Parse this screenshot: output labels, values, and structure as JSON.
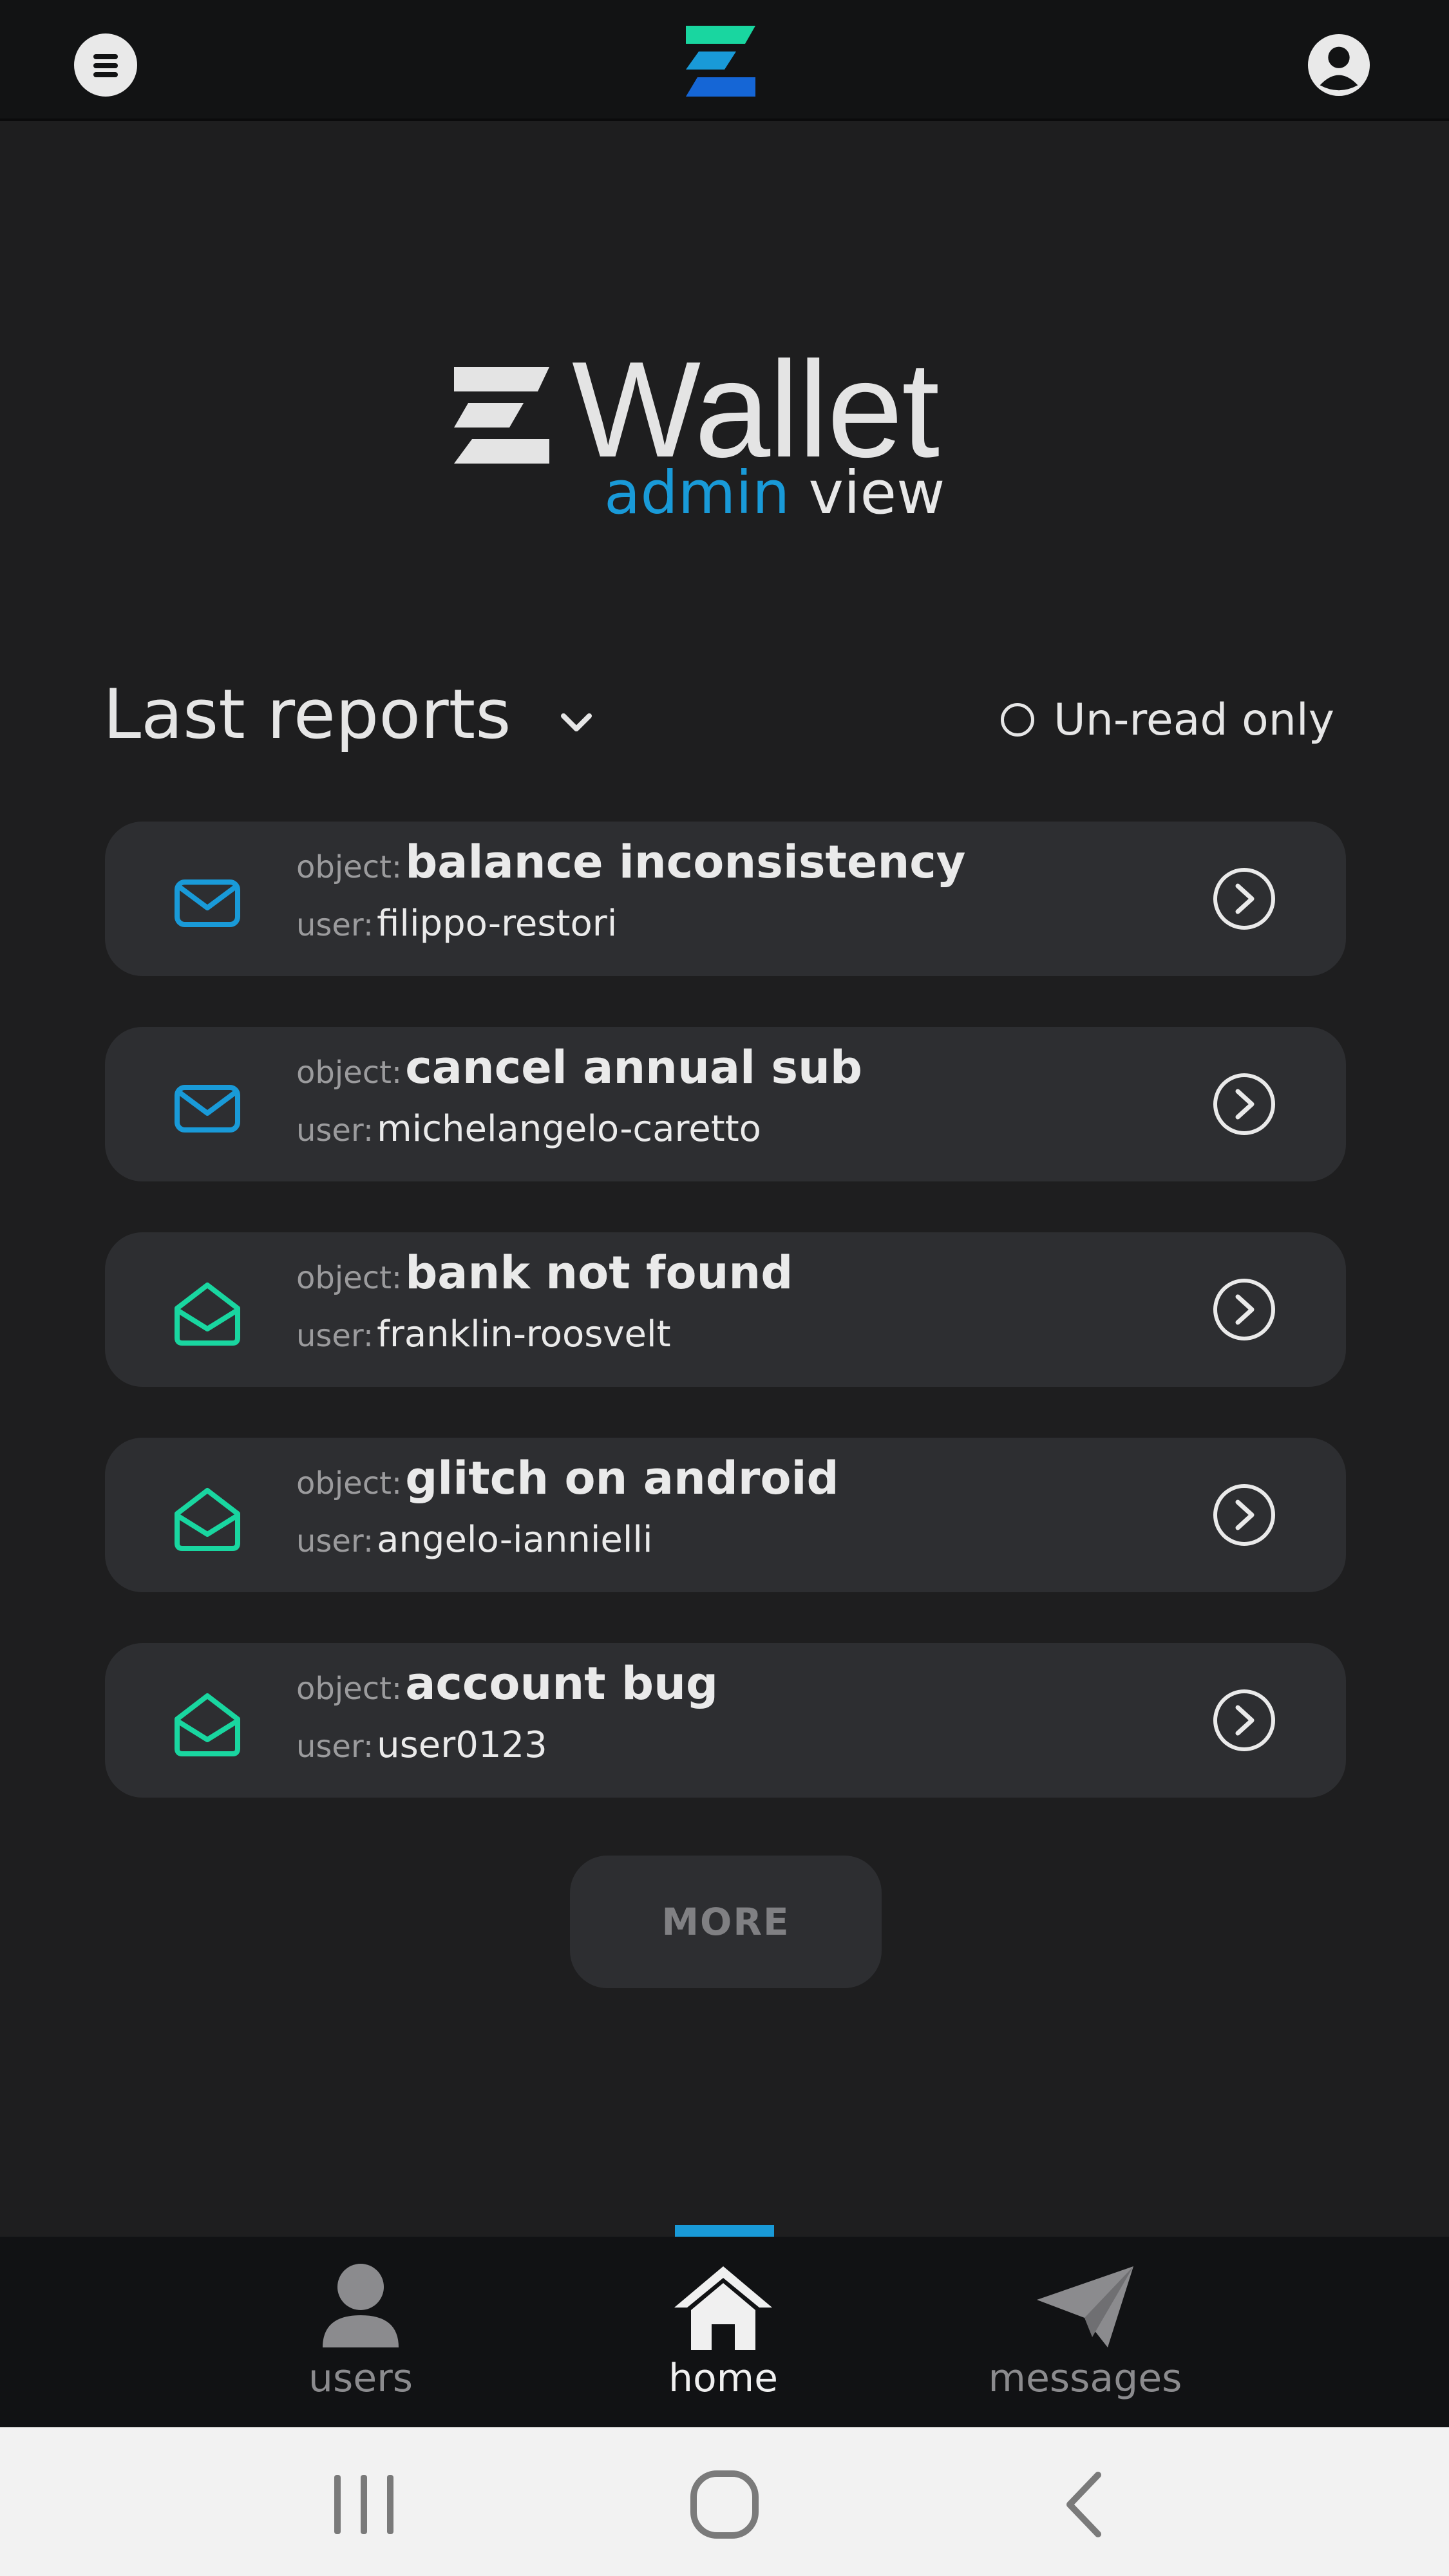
{
  "app": {
    "brand_title": "Wallet",
    "brand_sub_accent": "admin",
    "brand_sub_rest": " view"
  },
  "colors": {
    "accent_blue": "#199ad8",
    "accent_green": "#19d6a0",
    "card_bg": "#2d2e31",
    "page_bg": "#1e1e1f"
  },
  "section": {
    "title": "Last reports",
    "unread_label": "Un-read only",
    "unread_checked": false
  },
  "reports": [
    {
      "status": "unread",
      "object_key": "object:",
      "object": "balance inconsistency",
      "user_key": "user:",
      "user": "filippo-restori"
    },
    {
      "status": "unread",
      "object_key": "object:",
      "object": "cancel annual sub",
      "user_key": "user:",
      "user": "michelangelo-caretto"
    },
    {
      "status": "read",
      "object_key": "object:",
      "object": "bank not found",
      "user_key": "user:",
      "user": "franklin-roosvelt"
    },
    {
      "status": "read",
      "object_key": "object:",
      "object": "glitch on android",
      "user_key": "user:",
      "user": "angelo-iannielli"
    },
    {
      "status": "read",
      "object_key": "object:",
      "object": "account bug",
      "user_key": "user:",
      "user": "user0123"
    }
  ],
  "more_label": "MORE",
  "bottom_nav": {
    "users": "users",
    "home": "home",
    "messages": "messages",
    "active": "home"
  },
  "icons": {
    "topbar_left": "menu-icon",
    "topbar_center": "wallet-logo",
    "topbar_right": "profile-icon",
    "unread": "envelope-closed-icon",
    "read": "envelope-open-icon",
    "row_action": "arrow-right-circle-icon"
  }
}
